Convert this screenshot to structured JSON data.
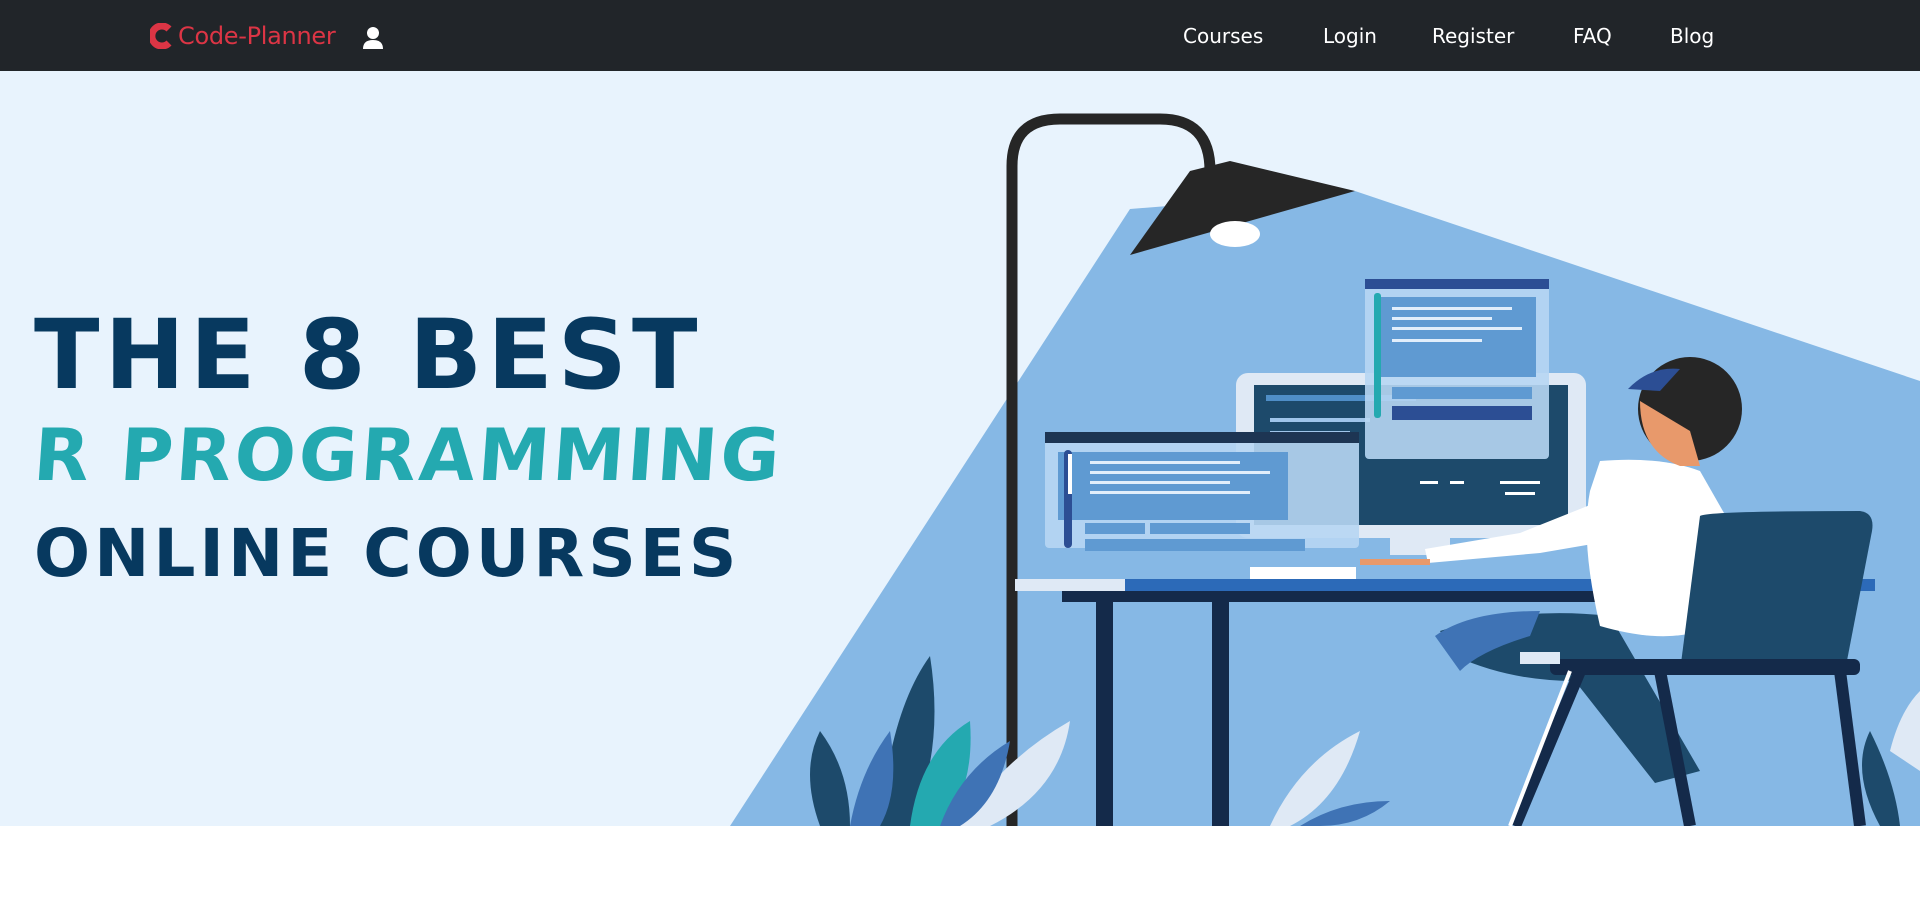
{
  "brand": {
    "name": "Code-Planner",
    "color": "#dc3545"
  },
  "nav": {
    "items": [
      {
        "label": "Courses"
      },
      {
        "label": "Login"
      },
      {
        "label": "Register"
      },
      {
        "label": "FAQ"
      },
      {
        "label": "Blog"
      }
    ]
  },
  "hero": {
    "line1": "THE 8 BEST",
    "line2": "R PROGRAMMING",
    "line3": "ONLINE COURSES",
    "colors": {
      "navy": "#07395f",
      "teal": "#24a9b0",
      "background": "#e8f3fd",
      "light_beam": "#86b8e5"
    }
  },
  "icons": {
    "brand": "code-planner-logo-icon",
    "account": "user-icon"
  }
}
